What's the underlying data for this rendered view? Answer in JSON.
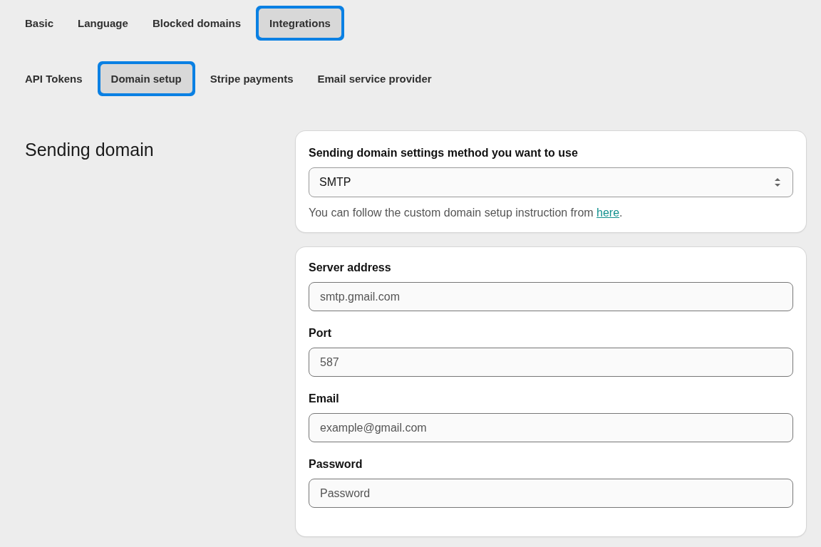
{
  "tabs": [
    {
      "label": "Basic",
      "selected": false
    },
    {
      "label": "Language",
      "selected": false
    },
    {
      "label": "Blocked domains",
      "selected": false
    },
    {
      "label": "Integrations",
      "selected": true
    }
  ],
  "subtabs": [
    {
      "label": "API Tokens",
      "selected": false
    },
    {
      "label": "Domain setup",
      "selected": true
    },
    {
      "label": "Stripe payments",
      "selected": false
    },
    {
      "label": "Email service provider",
      "selected": false
    }
  ],
  "section": {
    "title": "Sending domain"
  },
  "method_card": {
    "label": "Sending domain settings method you want to use",
    "select": {
      "value": "SMTP"
    },
    "help": {
      "text_before": "You can follow the custom domain setup instruction from ",
      "link": "here",
      "text_after": "."
    }
  },
  "smtp_card": {
    "fields": [
      {
        "label": "Server address",
        "placeholder": "smtp.gmail.com"
      },
      {
        "label": "Port",
        "placeholder": "587"
      },
      {
        "label": "Email",
        "placeholder": "example@gmail.com"
      },
      {
        "label": "Password",
        "placeholder": "Password"
      }
    ]
  }
}
